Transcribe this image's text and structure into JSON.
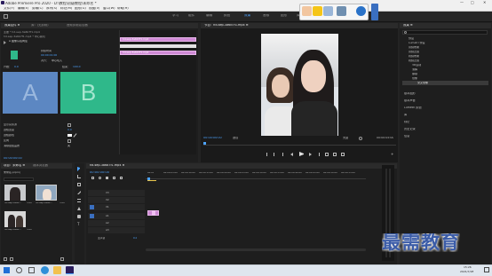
{
  "app": {
    "title": "Adobe Premiere Pro 2020 - D:\\教程\\初级教程\\未命名 *"
  },
  "window_controls": {
    "minimize": "—",
    "maximize": "□",
    "close": "✕"
  },
  "menu": [
    "文件(F)",
    "编辑(E)",
    "剪辑(C)",
    "序列(S)",
    "标记(M)",
    "图形(G)",
    "视图(V)",
    "窗口(W)",
    "帮助(H)"
  ],
  "workspaces": [
    "学习",
    "组件",
    "编辑",
    "颜色",
    "效果",
    "音频",
    "图形",
    "库"
  ],
  "active_workspace": "效果",
  "effect_controls": {
    "tabs": [
      "效果控件 ≡",
      "源：(无剪辑)",
      "音频剪辑混合器"
    ],
    "source_line": "主要 * hd-sep-3a6b7f1.mp4",
    "clip_line": "hd-sep-3a6b7f1.mp4 * 中心裁切",
    "effect_name": "交叉划像",
    "fx_label": "A 图像从右向左",
    "duration_label": "持续时间",
    "duration_value": "00:00:01:00",
    "align_label": "对齐：",
    "align_value": "中心切入",
    "start_label": "开始：",
    "start_value": "0.0",
    "end_label": "结束：",
    "end_value": "100.0",
    "a_label": "A",
    "b_label": "B",
    "props": [
      {
        "label": "显示实际源",
        "value": ""
      },
      {
        "label": "边框宽度",
        "value": "0.0"
      },
      {
        "label": "边框颜色",
        "value": ""
      },
      {
        "label": "反向",
        "value": ""
      },
      {
        "label": "消除锯齿品质",
        "value": "关"
      }
    ],
    "timecode": "00:00:00:00",
    "clips": [
      "hd-sep-3a6b7f1.mp4",
      "hd-sep-3a6b7f1.mp4"
    ]
  },
  "program": {
    "title": "节目：hd-sep-3a6b7f1.mp4 ≡",
    "timecode_left": "00:00:00:00",
    "fit": "适合",
    "quality": "完整",
    "timecode_right": "00:00:05:00"
  },
  "effects": {
    "title": "效果 ≡",
    "search_placeholder": "",
    "tree": [
      "预设",
      "Lumetri 预设",
      "音频效果",
      "音频过渡",
      "视频效果",
      "视频过渡",
      "3D运动",
      "溶解",
      "擦除",
      "划像",
      "交叉划像"
    ],
    "sections": [
      "基本图形",
      "基本声音",
      "Lumetri 颜色",
      "库",
      "标记",
      "历史记录",
      "信息"
    ]
  },
  "project": {
    "tabs": [
      "项目：未命名 ≡",
      "媒体浏览器"
    ],
    "file_label": "未命名.prproj",
    "items": [
      {
        "name": "hd-sep-3a6b...",
        "duration": "5:00"
      },
      {
        "name": "hd-sep-3a6b...",
        "duration": "5:00"
      },
      {
        "name": "hd-sep-3a6b...",
        "duration": "5:00"
      }
    ]
  },
  "timeline": {
    "tab": "hd-sep-3a6b7f1.mp4 ≡",
    "timecode": "00:00:00:00",
    "ruler": [
      "00:00",
      "00:00:05:00",
      "00:00:10:00",
      "00:00:15:00",
      "00:00:20:00",
      "00:00:25:00",
      "00:00:30:00",
      "00:00:35:00",
      "00:00:40:00",
      "00:00:45:00",
      "00:00:50:00",
      "00:00:55:00"
    ],
    "video_tracks": [
      "V3",
      "V2",
      "V1"
    ],
    "audio_tracks": [
      "A1",
      "A2",
      "A3"
    ],
    "master_label": "主声道",
    "master_value": "0.0"
  },
  "taskbar": {
    "time": "15:26",
    "date": "2021/7/28"
  },
  "watermark": "最需教育",
  "colors": {
    "accent": "#4da3ff",
    "clip": "#cf8ad5",
    "a_panel": "#5c87c2",
    "b_panel": "#2fb88a",
    "watermark": "#3b5ca8"
  }
}
